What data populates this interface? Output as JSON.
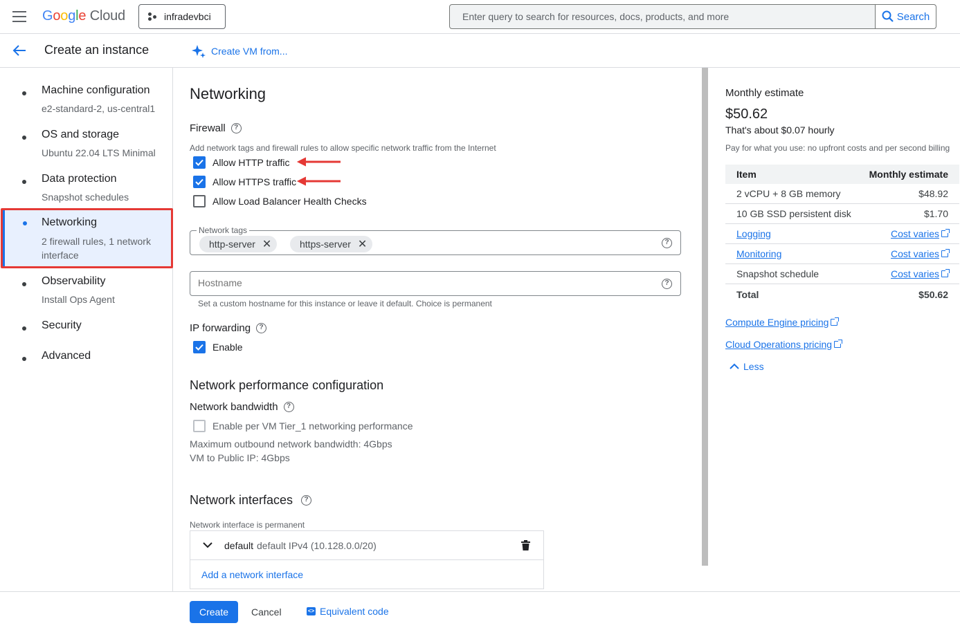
{
  "topbar": {
    "logo_google": [
      "G",
      "o",
      "o",
      "g",
      "l",
      "e"
    ],
    "logo_cloud": "Cloud",
    "project": "infradevbci",
    "search_placeholder": "Enter query to search for resources, docs, products, and more",
    "search_button": "Search"
  },
  "subheader": {
    "title": "Create an instance",
    "create_from": "Create VM from..."
  },
  "sidebar": {
    "items": [
      {
        "title": "Machine configuration",
        "sub": "e2-standard-2, us-central1"
      },
      {
        "title": "OS and storage",
        "sub": "Ubuntu 22.04 LTS Minimal"
      },
      {
        "title": "Data protection",
        "sub": "Snapshot schedules"
      },
      {
        "title": "Networking",
        "sub": "2 firewall rules, 1 network interface"
      },
      {
        "title": "Observability",
        "sub": "Install Ops Agent"
      },
      {
        "title": "Security",
        "sub": ""
      },
      {
        "title": "Advanced",
        "sub": ""
      }
    ]
  },
  "main": {
    "title": "Networking",
    "firewall": {
      "heading": "Firewall",
      "desc": "Add network tags and firewall rules to allow specific network traffic from the Internet",
      "options": [
        {
          "label": "Allow HTTP traffic",
          "checked": true
        },
        {
          "label": "Allow HTTPS traffic",
          "checked": true
        },
        {
          "label": "Allow Load Balancer Health Checks",
          "checked": false
        }
      ]
    },
    "network_tags": {
      "label": "Network tags",
      "chips": [
        "http-server",
        "https-server"
      ]
    },
    "hostname": {
      "placeholder": "Hostname",
      "hint": "Set a custom hostname for this instance or leave it default. Choice is permanent"
    },
    "ip_forwarding": {
      "heading": "IP forwarding",
      "enable_label": "Enable",
      "checked": true
    },
    "perf": {
      "heading": "Network performance configuration",
      "bandwidth_heading": "Network bandwidth",
      "tier1_label": "Enable per VM Tier_1 networking performance",
      "max_outbound": "Maximum outbound network bandwidth: 4Gbps",
      "vm_public": "VM to Public IP: 4Gbps"
    },
    "interfaces": {
      "heading": "Network interfaces",
      "note": "Network interface is permanent",
      "default_name": "default",
      "default_desc": "default IPv4 (10.128.0.0/20)",
      "add_label": "Add a network interface"
    }
  },
  "estimate": {
    "title": "Monthly estimate",
    "price": "$50.62",
    "hourly": "That's about $0.07 hourly",
    "note": "Pay for what you use: no upfront costs and per second billing",
    "col_item": "Item",
    "col_est": "Monthly estimate",
    "rows": [
      {
        "item": "2 vCPU + 8 GB memory",
        "value": "$48.92"
      },
      {
        "item": "10 GB SSD persistent disk",
        "value": "$1.70"
      },
      {
        "item": "Logging",
        "value": "Cost varies"
      },
      {
        "item": "Monitoring",
        "value": "Cost varies"
      },
      {
        "item": "Snapshot schedule",
        "value": "Cost varies"
      }
    ],
    "total_label": "Total",
    "total_value": "$50.62",
    "compute_link": "Compute Engine pricing",
    "ops_link": "Cloud Operations pricing",
    "less": "Less"
  },
  "footer": {
    "create": "Create",
    "cancel": "Cancel",
    "equivalent": "Equivalent code"
  },
  "colors": {
    "accent": "#1a73e8",
    "annotation": "#e53935"
  }
}
